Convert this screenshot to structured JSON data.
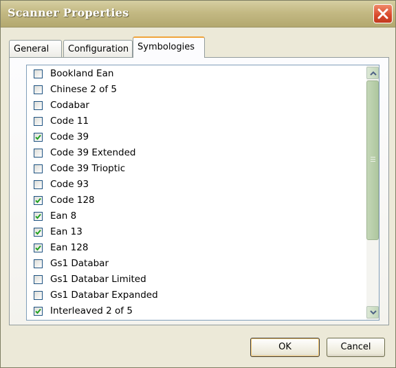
{
  "window": {
    "title": "Scanner Properties"
  },
  "tabs": [
    {
      "label": "General",
      "active": false
    },
    {
      "label": "Configuration",
      "active": false
    },
    {
      "label": "Symbologies",
      "active": true
    }
  ],
  "symbologies": [
    {
      "label": "Bookland Ean",
      "checked": false
    },
    {
      "label": "Chinese 2 of 5",
      "checked": false
    },
    {
      "label": "Codabar",
      "checked": false
    },
    {
      "label": "Code 11",
      "checked": false
    },
    {
      "label": "Code 39",
      "checked": true
    },
    {
      "label": "Code 39 Extended",
      "checked": false
    },
    {
      "label": "Code 39 Trioptic",
      "checked": false
    },
    {
      "label": "Code 93",
      "checked": false
    },
    {
      "label": "Code 128",
      "checked": true
    },
    {
      "label": "Ean 8",
      "checked": true
    },
    {
      "label": "Ean 13",
      "checked": true
    },
    {
      "label": "Ean 128",
      "checked": true
    },
    {
      "label": "Gs1 Databar",
      "checked": false
    },
    {
      "label": "Gs1 Databar Limited",
      "checked": false
    },
    {
      "label": "Gs1 Databar Expanded",
      "checked": false
    },
    {
      "label": "Interleaved 2 of 5",
      "checked": true
    }
  ],
  "buttons": {
    "ok": "OK",
    "cancel": "Cancel"
  },
  "colors": {
    "checkmark": "#21a121",
    "title_bar": "#c3b983",
    "close_button": "#d8482b"
  }
}
